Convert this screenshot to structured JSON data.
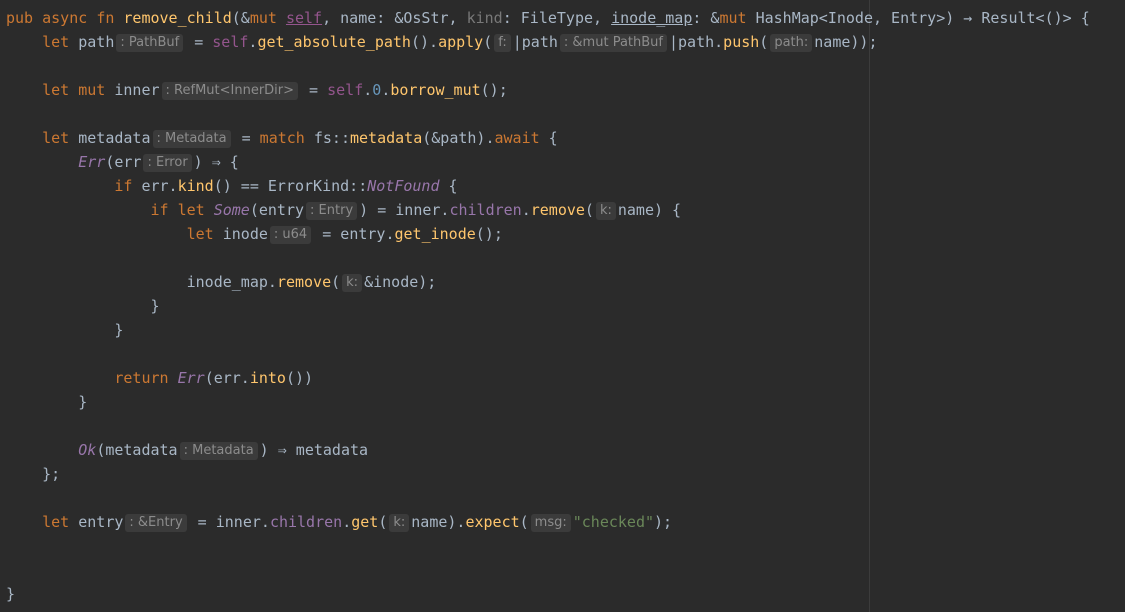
{
  "colors": {
    "background": "#2b2b2b",
    "keyword": "#cc7832",
    "function": "#ffc66d",
    "identifier": "#a9b7c6",
    "self": "#94558d",
    "field": "#9876aa",
    "number": "#6897bb",
    "string": "#6a8759",
    "inlay_hint_text": "#8c8c8c",
    "inlay_hint_bg": "#3b3b3b",
    "error_squiggle": "#b83b3b"
  },
  "code": {
    "lines": [
      {
        "squiggle": false,
        "tokens": [
          {
            "t": "pub",
            "c": "kw"
          },
          {
            "t": " "
          },
          {
            "t": "async",
            "c": "kw"
          },
          {
            "t": " "
          },
          {
            "t": "fn",
            "c": "kw"
          },
          {
            "t": " "
          },
          {
            "t": "remove_child",
            "c": "fn"
          },
          {
            "t": "(&"
          },
          {
            "t": "mut",
            "c": "kw"
          },
          {
            "t": " "
          },
          {
            "t": "self",
            "c": "selfu"
          },
          {
            "t": ", name: &OsStr, "
          },
          {
            "t": "kind",
            "c": "dim"
          },
          {
            "t": ": FileType, "
          },
          {
            "t": "inode_map",
            "c": "ul"
          },
          {
            "t": ": &"
          },
          {
            "t": "mut",
            "c": "kw"
          },
          {
            "t": " HashMap<Inode, Entry>) → Result<()> {"
          }
        ]
      },
      {
        "squiggle": true,
        "tokens": [
          {
            "t": "    "
          },
          {
            "t": "let",
            "c": "kw"
          },
          {
            "t": " path"
          },
          {
            "h": ": PathBuf"
          },
          {
            "t": " = "
          },
          {
            "t": "self",
            "c": "self"
          },
          {
            "t": "."
          },
          {
            "t": "get_absolute_path",
            "c": "fn"
          },
          {
            "t": "()."
          },
          {
            "t": "apply",
            "c": "fn"
          },
          {
            "t": "("
          },
          {
            "h": "f:"
          },
          {
            "t": "|path"
          },
          {
            "h": ": &mut PathBuf"
          },
          {
            "t": "|path."
          },
          {
            "t": "push",
            "c": "fn"
          },
          {
            "t": "("
          },
          {
            "h": "path:"
          },
          {
            "t": "name));"
          }
        ]
      },
      {
        "squiggle": false,
        "tokens": []
      },
      {
        "squiggle": true,
        "tokens": [
          {
            "t": "    "
          },
          {
            "t": "let",
            "c": "kw"
          },
          {
            "t": " "
          },
          {
            "t": "mut",
            "c": "kw"
          },
          {
            "t": " inner"
          },
          {
            "h": ": RefMut<InnerDir>"
          },
          {
            "t": " = "
          },
          {
            "t": "self",
            "c": "self"
          },
          {
            "t": "."
          },
          {
            "t": "0",
            "c": "num"
          },
          {
            "t": "."
          },
          {
            "t": "borrow_mut",
            "c": "fn"
          },
          {
            "t": "();"
          }
        ]
      },
      {
        "squiggle": false,
        "tokens": []
      },
      {
        "squiggle": true,
        "tokens": [
          {
            "t": "    "
          },
          {
            "t": "let",
            "c": "kw"
          },
          {
            "t": " metadata"
          },
          {
            "h": ": Metadata"
          },
          {
            "t": " = "
          },
          {
            "t": "match",
            "c": "kw"
          },
          {
            "t": " fs::"
          },
          {
            "t": "metadata",
            "c": "fn"
          },
          {
            "t": "(&path)."
          },
          {
            "t": "await",
            "c": "kw"
          },
          {
            "t": " {"
          }
        ]
      },
      {
        "squiggle": true,
        "tokens": [
          {
            "t": "        "
          },
          {
            "t": "Err",
            "c": "enum"
          },
          {
            "t": "(err"
          },
          {
            "h": ": Error"
          },
          {
            "t": ") ⇒ {"
          }
        ]
      },
      {
        "squiggle": true,
        "tokens": [
          {
            "t": "            "
          },
          {
            "t": "if",
            "c": "kw"
          },
          {
            "t": " err."
          },
          {
            "t": "kind",
            "c": "fn"
          },
          {
            "t": "() == ErrorKind::"
          },
          {
            "t": "NotFound",
            "c": "enum"
          },
          {
            "t": " {"
          }
        ]
      },
      {
        "squiggle": true,
        "tokens": [
          {
            "t": "                "
          },
          {
            "t": "if",
            "c": "kw"
          },
          {
            "t": " "
          },
          {
            "t": "let",
            "c": "kw"
          },
          {
            "t": " "
          },
          {
            "t": "Some",
            "c": "enum"
          },
          {
            "t": "(entry"
          },
          {
            "h": ": Entry"
          },
          {
            "t": ") = inner."
          },
          {
            "t": "children",
            "c": "field"
          },
          {
            "t": "."
          },
          {
            "t": "remove",
            "c": "fn"
          },
          {
            "t": "("
          },
          {
            "h": "k:"
          },
          {
            "t": "name) {"
          }
        ]
      },
      {
        "squiggle": true,
        "tokens": [
          {
            "t": "                    "
          },
          {
            "t": "let",
            "c": "kw"
          },
          {
            "t": " inode"
          },
          {
            "h": ": u64"
          },
          {
            "t": " = entry."
          },
          {
            "t": "get_inode",
            "c": "fn"
          },
          {
            "t": "();"
          }
        ]
      },
      {
        "squiggle": false,
        "tokens": []
      },
      {
        "squiggle": true,
        "tokens": [
          {
            "t": "                    inode_map."
          },
          {
            "t": "remove",
            "c": "fn"
          },
          {
            "t": "("
          },
          {
            "h": "k:"
          },
          {
            "t": "&inode);"
          }
        ]
      },
      {
        "squiggle": true,
        "tokens": [
          {
            "t": "                }"
          }
        ]
      },
      {
        "squiggle": true,
        "tokens": [
          {
            "t": "            }"
          }
        ]
      },
      {
        "squiggle": false,
        "tokens": []
      },
      {
        "squiggle": true,
        "tokens": [
          {
            "t": "            "
          },
          {
            "t": "return",
            "c": "kw"
          },
          {
            "t": " "
          },
          {
            "t": "Err",
            "c": "enum"
          },
          {
            "t": "(err."
          },
          {
            "t": "into",
            "c": "fn"
          },
          {
            "t": "())"
          }
        ]
      },
      {
        "squiggle": true,
        "tokens": [
          {
            "t": "        }"
          }
        ]
      },
      {
        "squiggle": false,
        "tokens": []
      },
      {
        "squiggle": true,
        "tokens": [
          {
            "t": "        "
          },
          {
            "t": "Ok",
            "c": "enum"
          },
          {
            "t": "(metadata"
          },
          {
            "h": ": Metadata"
          },
          {
            "t": ") ⇒ metadata"
          }
        ]
      },
      {
        "squiggle": true,
        "tokens": [
          {
            "t": "    };"
          }
        ]
      },
      {
        "squiggle": false,
        "tokens": []
      },
      {
        "squiggle": true,
        "tokens": [
          {
            "t": "    "
          },
          {
            "t": "let",
            "c": "kw"
          },
          {
            "t": " entry"
          },
          {
            "h": ": &Entry"
          },
          {
            "t": " = inner."
          },
          {
            "t": "children",
            "c": "field"
          },
          {
            "t": "."
          },
          {
            "t": "get",
            "c": "fn"
          },
          {
            "t": "("
          },
          {
            "h": "k:"
          },
          {
            "t": "name)."
          },
          {
            "t": "expect",
            "c": "fn"
          },
          {
            "t": "("
          },
          {
            "h": "msg:"
          },
          {
            "t": "\"checked\"",
            "c": "str"
          },
          {
            "t": ");"
          }
        ]
      },
      {
        "squiggle": false,
        "tokens": []
      },
      {
        "squiggle": false,
        "tokens": []
      },
      {
        "squiggle": true,
        "tokens": [
          {
            "t": "}"
          }
        ]
      }
    ]
  }
}
